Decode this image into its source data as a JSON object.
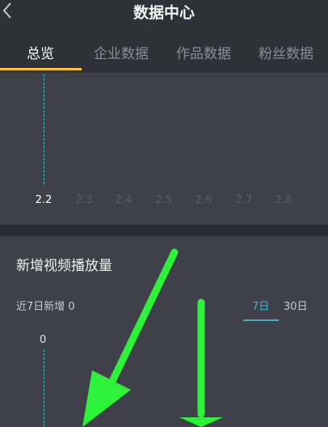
{
  "header": {
    "title": "数据中心",
    "back_icon": "chevron-left-icon"
  },
  "tabs": [
    {
      "label": "总览",
      "active": true
    },
    {
      "label": "企业数据",
      "active": false
    },
    {
      "label": "作品数据",
      "active": false
    },
    {
      "label": "粉丝数据",
      "active": false
    }
  ],
  "trend_chart": {
    "dates": [
      "2.2",
      "2.3",
      "2.4",
      "2.5",
      "2.6",
      "2.7",
      "2.8"
    ],
    "selected_index": 0
  },
  "video_plays": {
    "title": "新增视频播放量",
    "summary": "近7日新增 0",
    "ranges": [
      {
        "label": "7日",
        "active": true
      },
      {
        "label": "30日",
        "active": false
      }
    ],
    "selected_value": "0"
  },
  "colors": {
    "accent_tab": "#f5c52c",
    "accent_range": "#3fb6c6",
    "annotation_arrow": "#2ef23a"
  },
  "annotation_icons": [
    "green-arrow-icon",
    "green-arrow-icon"
  ]
}
